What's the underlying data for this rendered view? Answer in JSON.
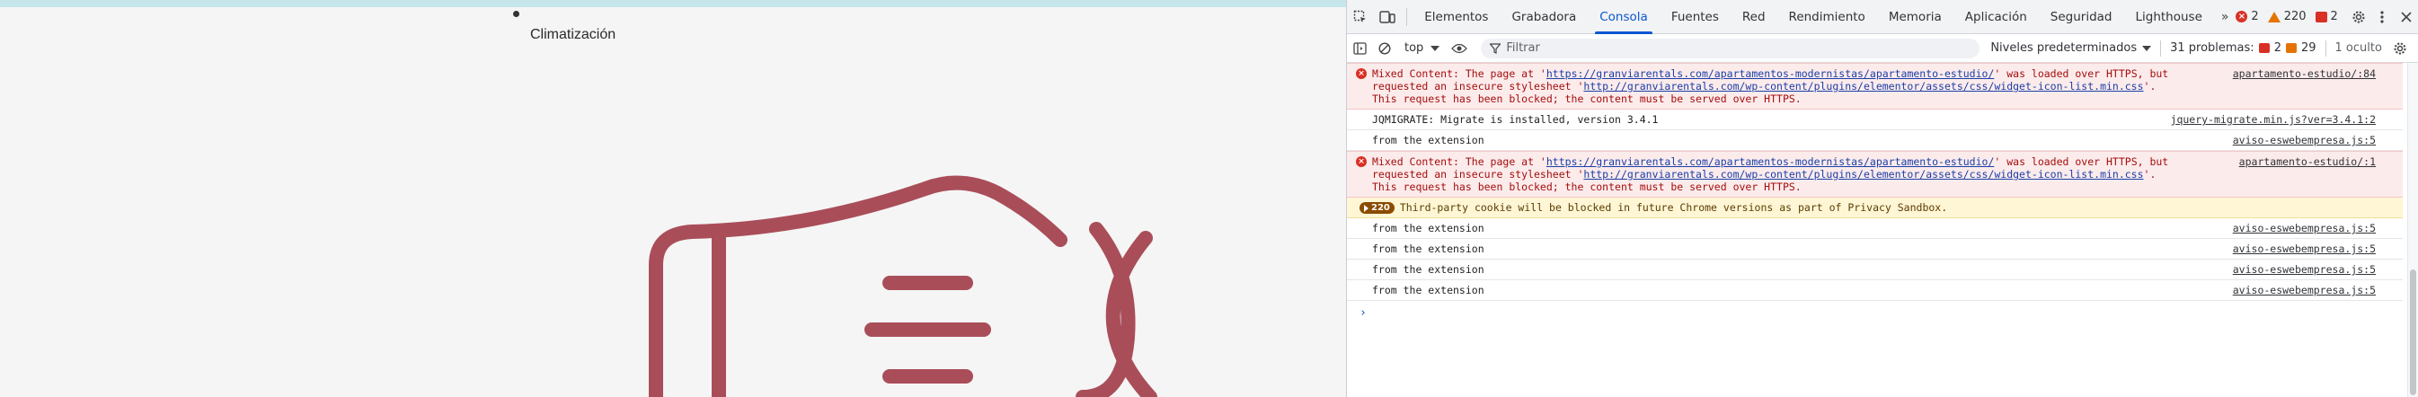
{
  "page": {
    "heading": "Climatización",
    "accent_color": "#a94e59"
  },
  "devtools": {
    "tabs": [
      {
        "label": "Elementos"
      },
      {
        "label": "Grabadora"
      },
      {
        "label": "Consola",
        "active": true
      },
      {
        "label": "Fuentes"
      },
      {
        "label": "Red"
      },
      {
        "label": "Rendimiento"
      },
      {
        "label": "Memoria"
      },
      {
        "label": "Aplicación"
      },
      {
        "label": "Seguridad"
      },
      {
        "label": "Lighthouse"
      }
    ],
    "more_tabs": "»",
    "counts": {
      "errors": "2",
      "warnings": "220",
      "issues": "2"
    },
    "toolbar": {
      "context": "top",
      "filter_placeholder": "Filtrar",
      "levels": "Niveles predeterminados",
      "problems_label": "31 problemas:",
      "problems_errors": "2",
      "problems_warnings": "29",
      "hidden": "1 oculto"
    },
    "log": [
      {
        "type": "error",
        "pre": "Mixed Content: The page at '",
        "link1": "https://granviarentals.com/apartamentos-modernistas/apartamento-estudio/",
        "mid": "' was loaded over HTTPS, but requested an insecure stylesheet '",
        "link2": "http://granviarentals.com/wp-content/plugins/elementor/assets/css/widget-icon-list.min.css",
        "post": "'. This request has been blocked; the content must be served over HTTPS.",
        "source": "apartamento-estudio/:84"
      },
      {
        "type": "info",
        "text": "JQMIGRATE: Migrate is installed, version 3.4.1",
        "source": "jquery-migrate.min.js?ver=3.4.1:2"
      },
      {
        "type": "info",
        "text": "from the extension",
        "source": "aviso-eswebempresa.js:5"
      },
      {
        "type": "error",
        "pre": "Mixed Content: The page at '",
        "link1": "https://granviarentals.com/apartamentos-modernistas/apartamento-estudio/",
        "mid": "' was loaded over HTTPS, but requested an insecure stylesheet '",
        "link2": "http://granviarentals.com/wp-content/plugins/elementor/assets/css/widget-icon-list.min.css",
        "post": "'. This request has been blocked; the content must be served over HTTPS.",
        "source": "apartamento-estudio/:1"
      },
      {
        "type": "warn",
        "count": "220",
        "text": "Third-party cookie will be blocked in future Chrome versions as part of Privacy Sandbox."
      },
      {
        "type": "info",
        "text": "from the extension",
        "source": "aviso-eswebempresa.js:5"
      },
      {
        "type": "info",
        "text": "from the extension",
        "source": "aviso-eswebempresa.js:5"
      },
      {
        "type": "info",
        "text": "from the extension",
        "source": "aviso-eswebempresa.js:5"
      },
      {
        "type": "info",
        "text": "from the extension",
        "source": "aviso-eswebempresa.js:5"
      }
    ],
    "prompt": "›"
  }
}
